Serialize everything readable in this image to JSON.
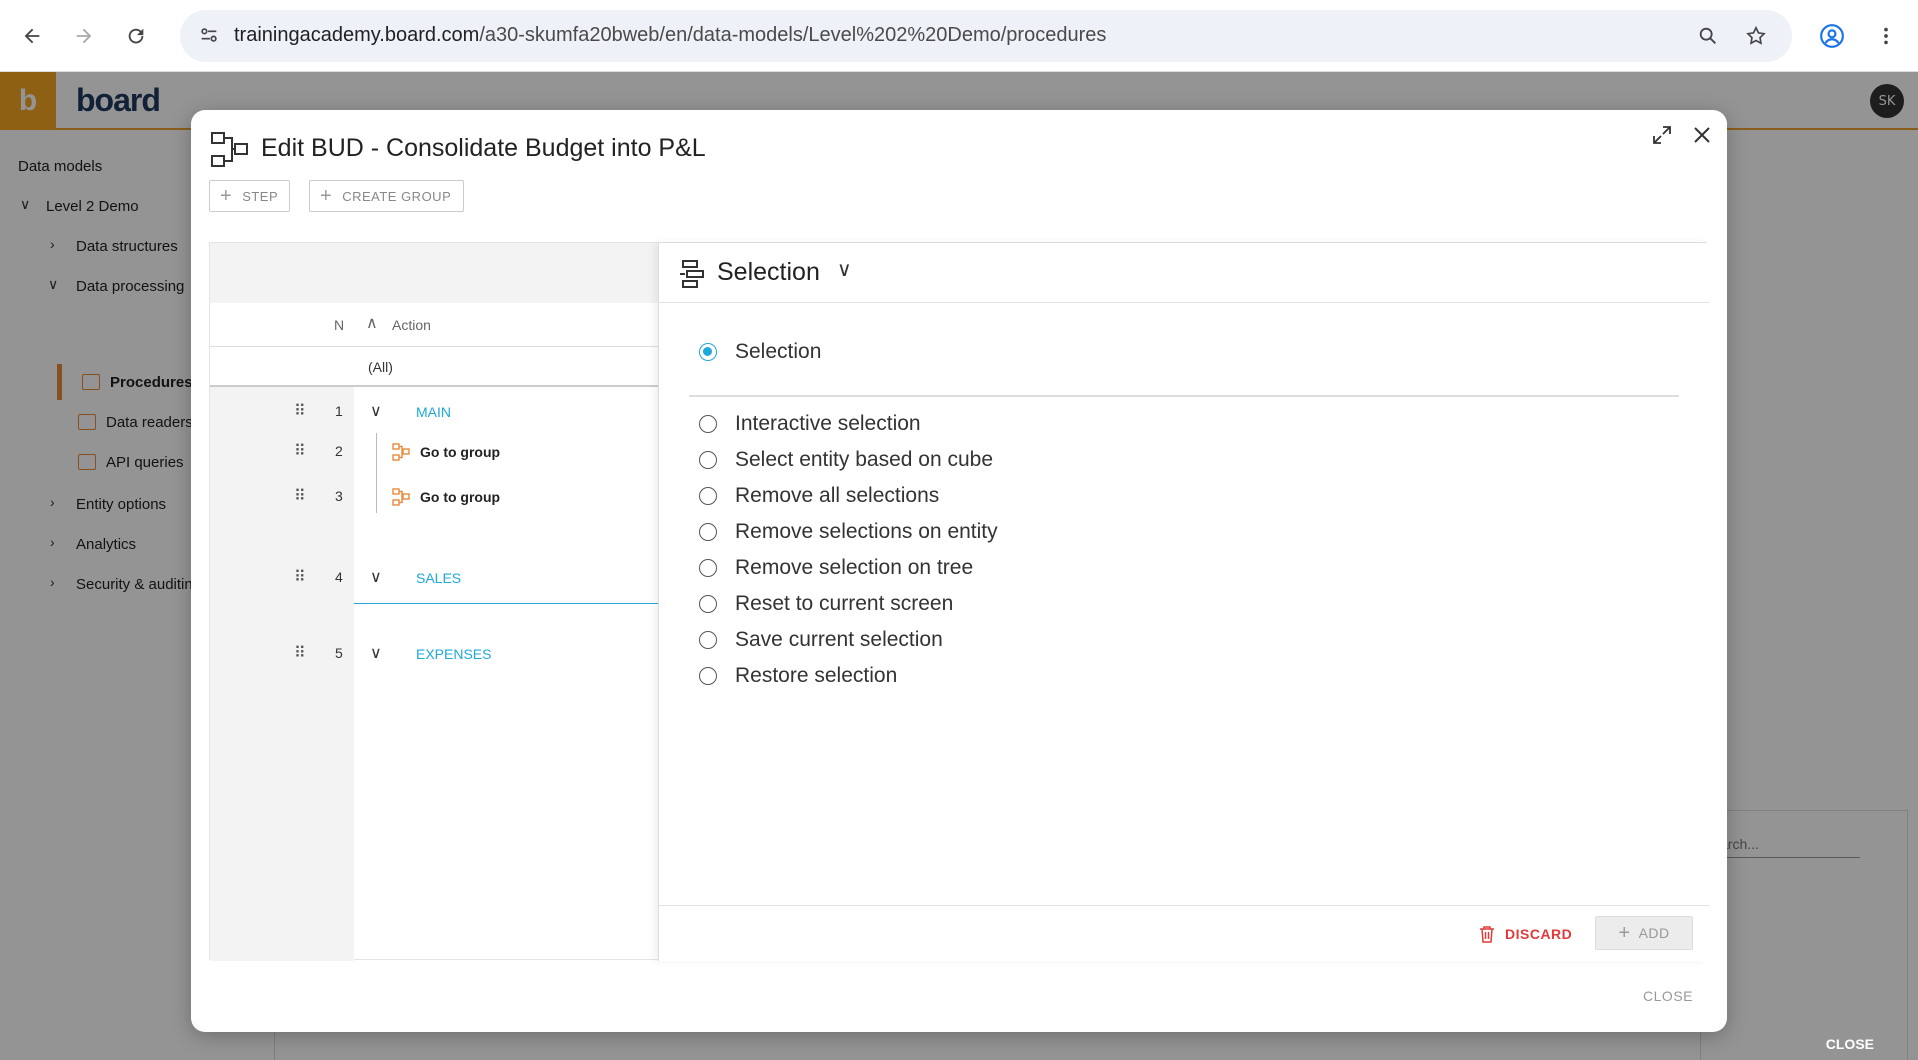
{
  "browser": {
    "url_domain": "trainingacademy.board.com",
    "url_path": "/a30-skumfa20bweb/en/data-models/Level%202%20Demo/procedures"
  },
  "app": {
    "logo_letter": "b",
    "brand": "board",
    "avatar": "SK"
  },
  "sidebar": {
    "root": "Data models",
    "model": "Level 2 Demo",
    "items": [
      {
        "label": "Data structures"
      },
      {
        "label": "Data processing"
      },
      {
        "label": "Procedures"
      },
      {
        "label": "Data readers"
      },
      {
        "label": "API queries"
      },
      {
        "label": "Entity options"
      },
      {
        "label": "Analytics"
      },
      {
        "label": "Security & auditin"
      }
    ]
  },
  "background": {
    "search_placeholder": "arch...",
    "close_label": "CLOSE"
  },
  "modal": {
    "title": "Edit BUD - Consolidate Budget into P&L",
    "toolbar": {
      "step_label": "STEP",
      "create_group_label": "CREATE GROUP"
    },
    "grid": {
      "col_n": "N",
      "col_action": "Action",
      "filter_all": "(All)",
      "rows": [
        {
          "n": "1",
          "type": "group",
          "label": "MAIN"
        },
        {
          "n": "2",
          "type": "action",
          "label": "Go to group"
        },
        {
          "n": "3",
          "type": "action",
          "label": "Go to group"
        },
        {
          "n": "4",
          "type": "group",
          "label": "SALES"
        },
        {
          "n": "5",
          "type": "group",
          "label": "EXPENSES"
        }
      ]
    },
    "editor": {
      "title": "Selection",
      "primary_option": "Selection",
      "options": [
        "Interactive selection",
        "Select entity based on cube",
        "Remove all selections",
        "Remove selections on entity",
        "Remove selection on tree",
        "Reset to current screen",
        "Save current selection",
        "Restore selection"
      ],
      "discard_label": "DISCARD",
      "add_label": "ADD"
    },
    "close_label": "CLOSE"
  },
  "colors": {
    "accent": "#1ea9d8",
    "brand_orange": "#f5a623",
    "danger": "#e03b3b"
  }
}
